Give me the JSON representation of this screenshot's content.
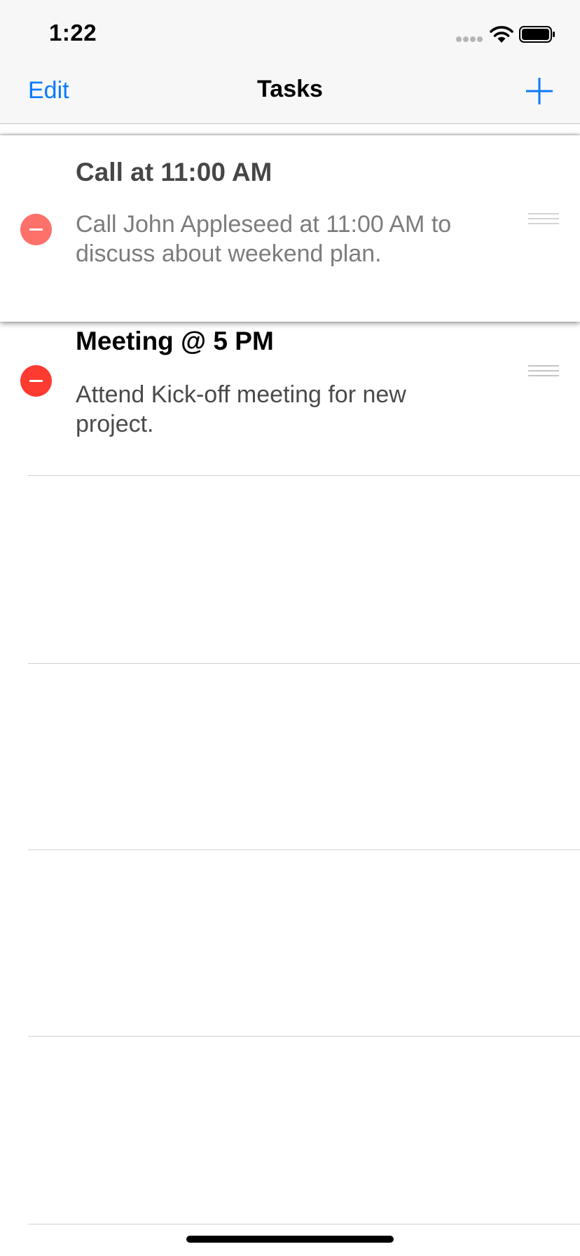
{
  "status_bar": {
    "time": "1:22",
    "icons": [
      "signal-dots-icon",
      "wifi-icon",
      "battery-icon"
    ]
  },
  "nav": {
    "edit_label": "Edit",
    "title": "Tasks",
    "add_icon": "plus-icon"
  },
  "tasks": [
    {
      "title": "Call at 11:00 AM",
      "description": "Call John Appleseed at 11:00 AM to discuss about weekend plan.",
      "state": "dragging"
    },
    {
      "title": "Meeting @ 5 PM",
      "description": "Attend Kick-off meeting for new project.",
      "state": "editing"
    }
  ],
  "colors": {
    "accent": "#0a7aff",
    "delete": "#fd3b31",
    "bar_background": "#f7f7f7",
    "separator": "#d1d1d6"
  }
}
